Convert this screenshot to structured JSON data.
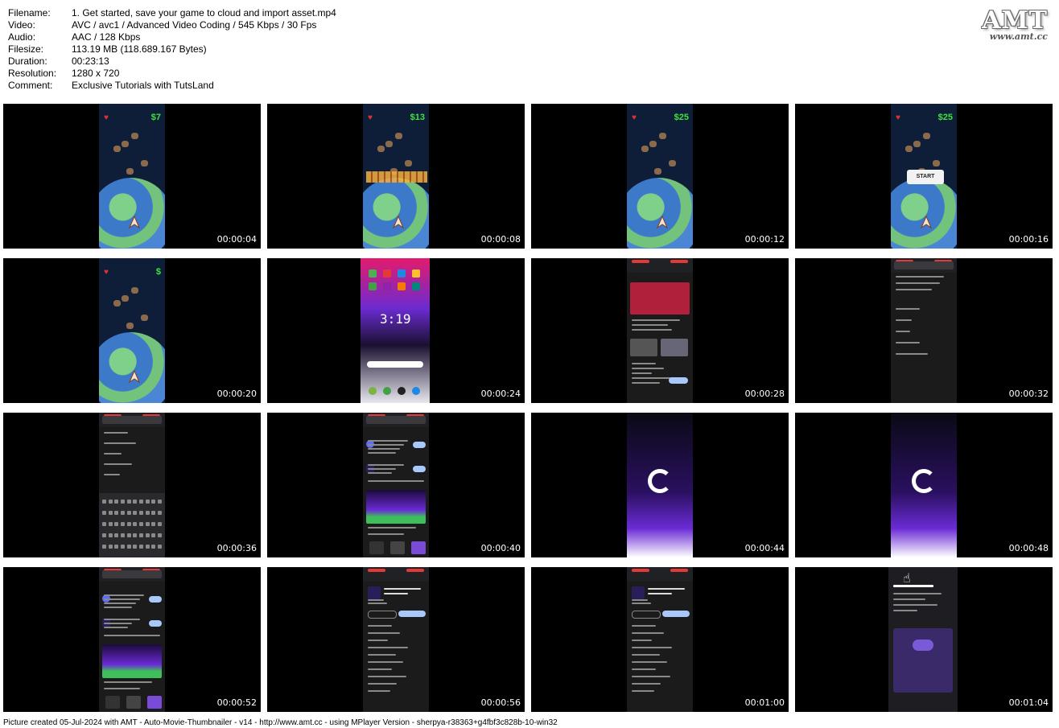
{
  "meta": [
    {
      "key": "Filename:",
      "value": "1. Get started, save your game to cloud and import asset.mp4"
    },
    {
      "key": "Video:",
      "value": "AVC / avc1 / Advanced Video Coding / 545 Kbps / 30 Fps"
    },
    {
      "key": "Audio:",
      "value": "AAC / 128 Kbps"
    },
    {
      "key": "Filesize:",
      "value": "113.19 MB (118.689.167 Bytes)"
    },
    {
      "key": "Duration:",
      "value": "00:23:13"
    },
    {
      "key": "Resolution:",
      "value": "1280 x 720"
    },
    {
      "key": "Comment:",
      "value": "Exclusive Tutorials with TutsLand"
    }
  ],
  "logo": {
    "title": "AMT",
    "url": "www.amt.cc"
  },
  "thumbnails": [
    {
      "time": "00:00:04",
      "scene": "game",
      "money": "$7"
    },
    {
      "time": "00:00:08",
      "scene": "game-title",
      "money": "$13"
    },
    {
      "time": "00:00:12",
      "scene": "game",
      "money": "$25"
    },
    {
      "time": "00:00:16",
      "scene": "game-start",
      "money": "$25",
      "button": "START"
    },
    {
      "time": "00:00:20",
      "scene": "game",
      "money": "$"
    },
    {
      "time": "00:00:24",
      "scene": "home",
      "clock": "3:19"
    },
    {
      "time": "00:00:28",
      "scene": "store"
    },
    {
      "time": "00:00:32",
      "scene": "search"
    },
    {
      "time": "00:00:36",
      "scene": "keyboard"
    },
    {
      "time": "00:00:40",
      "scene": "results"
    },
    {
      "time": "00:00:44",
      "scene": "splash"
    },
    {
      "time": "00:00:48",
      "scene": "splash"
    },
    {
      "time": "00:00:52",
      "scene": "results"
    },
    {
      "time": "00:00:56",
      "scene": "app-page"
    },
    {
      "time": "00:01:00",
      "scene": "app-page"
    },
    {
      "time": "00:01:04",
      "scene": "lessons"
    }
  ],
  "footer": "Picture created 05-Jul-2024 with AMT - Auto-Movie-Thumbnailer - v14 - http://www.amt.cc - using MPlayer Version - sherpya-r38363+g4fbf3c828b-10-win32"
}
